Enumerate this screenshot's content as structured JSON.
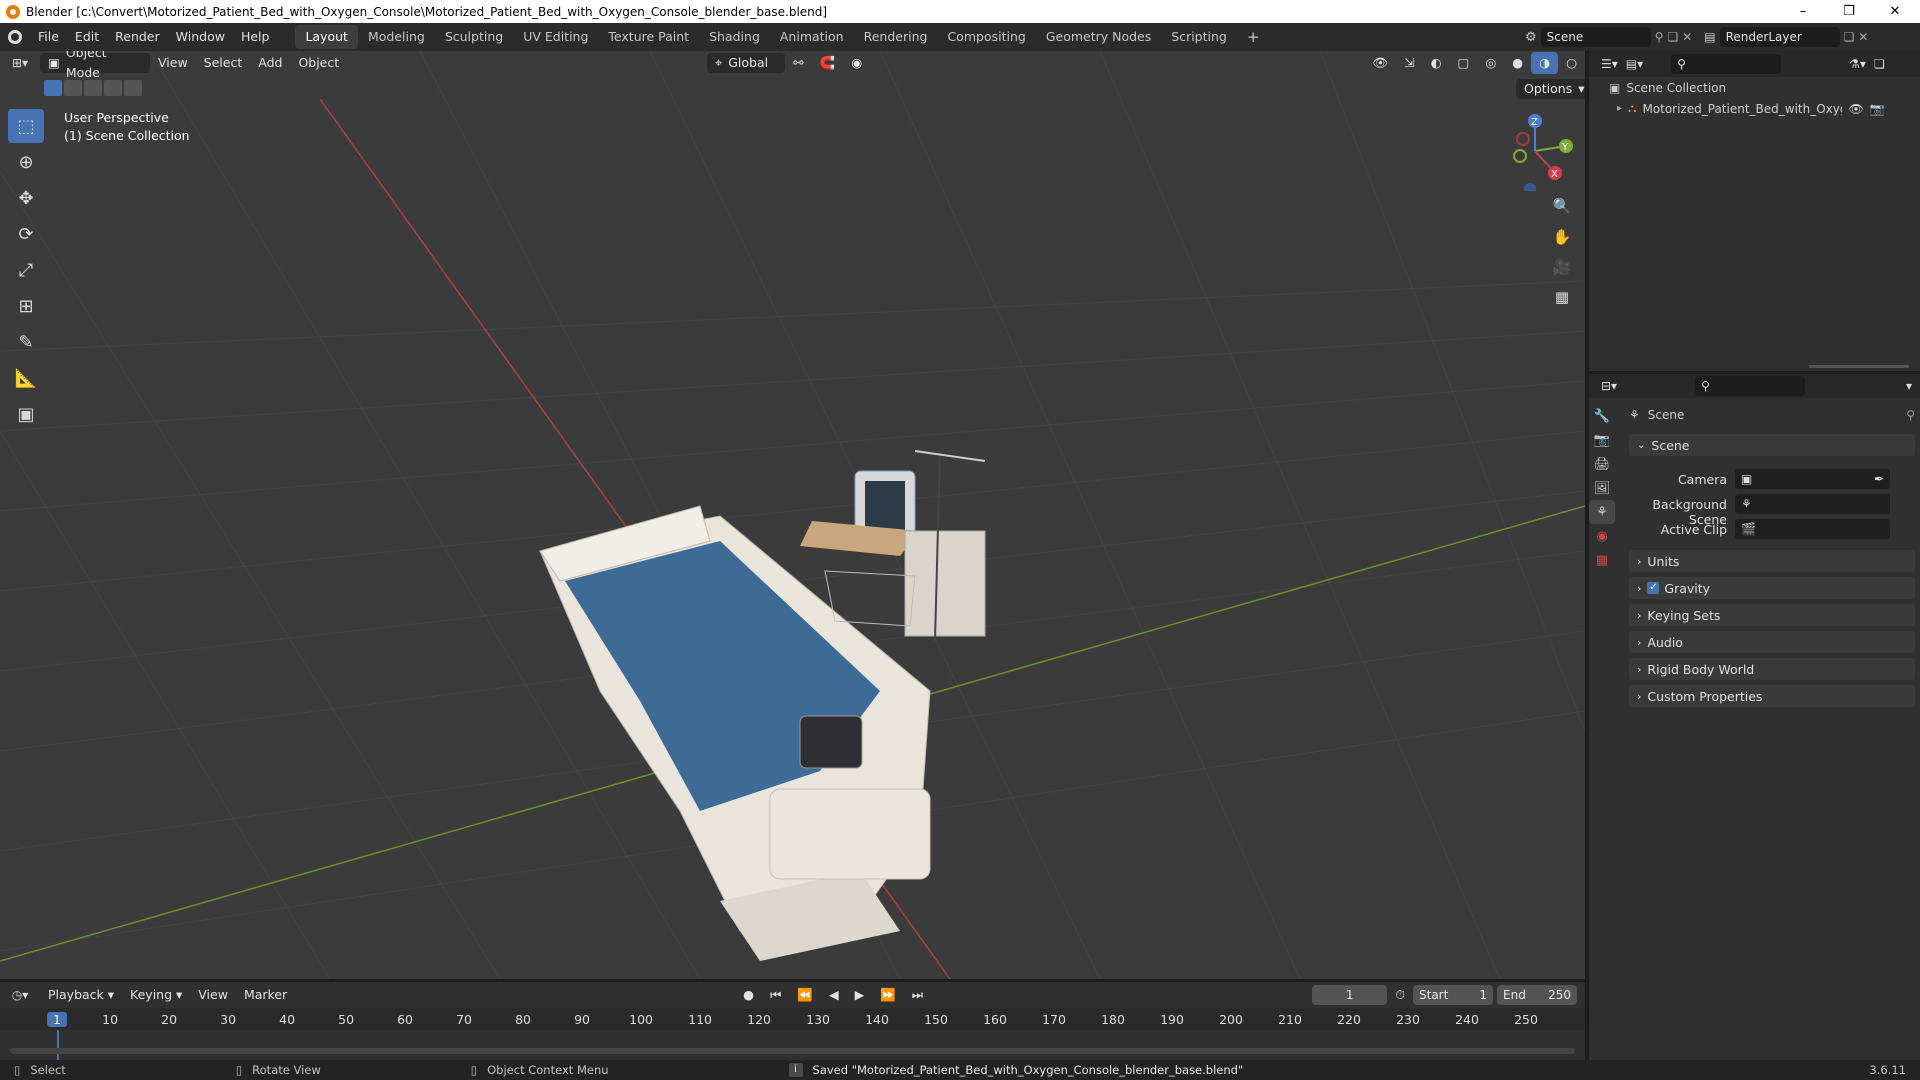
{
  "window": {
    "title": "Blender [c:\\Convert\\Motorized_Patient_Bed_with_Oxygen_Console\\Motorized_Patient_Bed_with_Oxygen_Console_blender_base.blend]",
    "minimize": "–",
    "maximize": "❐",
    "close": "✕"
  },
  "menu": [
    "File",
    "Edit",
    "Render",
    "Window",
    "Help"
  ],
  "workspaces": [
    "Layout",
    "Modeling",
    "Sculpting",
    "UV Editing",
    "Texture Paint",
    "Shading",
    "Animation",
    "Rendering",
    "Compositing",
    "Geometry Nodes",
    "Scripting"
  ],
  "active_workspace": "Layout",
  "add_workspace": "+",
  "scene_selector": {
    "value": "Scene"
  },
  "view_layer_selector": {
    "value": "RenderLayer"
  },
  "viewport": {
    "mode": "Object Mode",
    "menus": [
      "View",
      "Select",
      "Add",
      "Object"
    ],
    "transform_orientation": "Global",
    "options_label": "Options",
    "overlay_text_line1": "User Perspective",
    "overlay_text_line2": "(1) Scene Collection",
    "gizmo": {
      "z": "Z",
      "y": "Y",
      "x": "X"
    }
  },
  "outliner": {
    "root": "Scene Collection",
    "items": [
      {
        "label": "Motorized_Patient_Bed_with_Oxygen_C"
      }
    ]
  },
  "properties": {
    "context_title": "Scene",
    "section_scene": "Scene",
    "camera_label": "Camera",
    "background_scene_label": "Background Scene",
    "active_clip_label": "Active Clip",
    "panels": [
      {
        "label": "Units",
        "checkbox": false
      },
      {
        "label": "Gravity",
        "checkbox": true
      },
      {
        "label": "Keying Sets",
        "checkbox": false
      },
      {
        "label": "Audio",
        "checkbox": false
      },
      {
        "label": "Rigid Body World",
        "checkbox": false
      },
      {
        "label": "Custom Properties",
        "checkbox": false
      }
    ]
  },
  "timeline": {
    "menus": [
      "Playback",
      "Keying",
      "View",
      "Marker"
    ],
    "current_frame": "1",
    "start_label": "Start",
    "start_value": "1",
    "end_label": "End",
    "end_value": "250",
    "ruler": [
      "1",
      "10",
      "20",
      "30",
      "40",
      "50",
      "60",
      "70",
      "80",
      "90",
      "100",
      "110",
      "120",
      "130",
      "140",
      "150",
      "160",
      "170",
      "180",
      "190",
      "200",
      "210",
      "220",
      "230",
      "240",
      "250"
    ]
  },
  "status_bar": {
    "select": "Select",
    "rotate": "Rotate View",
    "context_menu": "Object Context Menu",
    "message": "Saved \"Motorized_Patient_Bed_with_Oxygen_Console_blender_base.blend\"",
    "version": "3.6.11"
  }
}
